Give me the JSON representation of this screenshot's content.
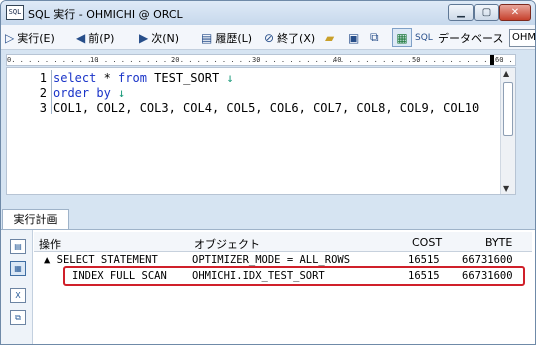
{
  "window": {
    "title": "SQL 実行 - OHMICHI @ ORCL",
    "icon_label": "SQL"
  },
  "toolbar": {
    "execute_label": "実行(E)",
    "prev_label": "前(P)",
    "next_label": "次(N)",
    "history_label": "履歴(L)",
    "end_label": "終了(X)",
    "database_label": "データベース",
    "database_value": "OHMI"
  },
  "ruler": {
    "marks": [
      "10",
      "20",
      "30",
      "40",
      "50",
      "60"
    ]
  },
  "editor": {
    "lines": [
      {
        "no": "1",
        "kw": "select",
        "rest": " * ",
        "kw2": "from",
        "tail": " TEST_SORT ",
        "arrow": "↓"
      },
      {
        "no": "2",
        "kw": "order by",
        "rest": " ",
        "kw2": "",
        "tail": "",
        "arrow": "↓"
      },
      {
        "no": "3",
        "kw": "",
        "rest": "COL1, COL2, COL3, COL4, COL5, COL6, COL7, COL8, COL9, COL10",
        "kw2": "",
        "tail": "",
        "arrow": ""
      }
    ]
  },
  "plan": {
    "tab_label": "実行計画",
    "columns": {
      "operation": "操作",
      "object": "オブジェクト",
      "cost": "COST",
      "byte": "BYTE"
    },
    "rows": [
      {
        "operation": "▲ SELECT STATEMENT",
        "object": "OPTIMIZER_MODE = ALL_ROWS",
        "cost": "16515",
        "byte": "66731600"
      },
      {
        "operation": "INDEX FULL SCAN",
        "object": "OHMICHI.IDX_TEST_SORT",
        "cost": "16515",
        "byte": "66731600"
      }
    ]
  },
  "colors": {
    "highlight": "#d0202a",
    "keyword": "#1a34c8"
  }
}
